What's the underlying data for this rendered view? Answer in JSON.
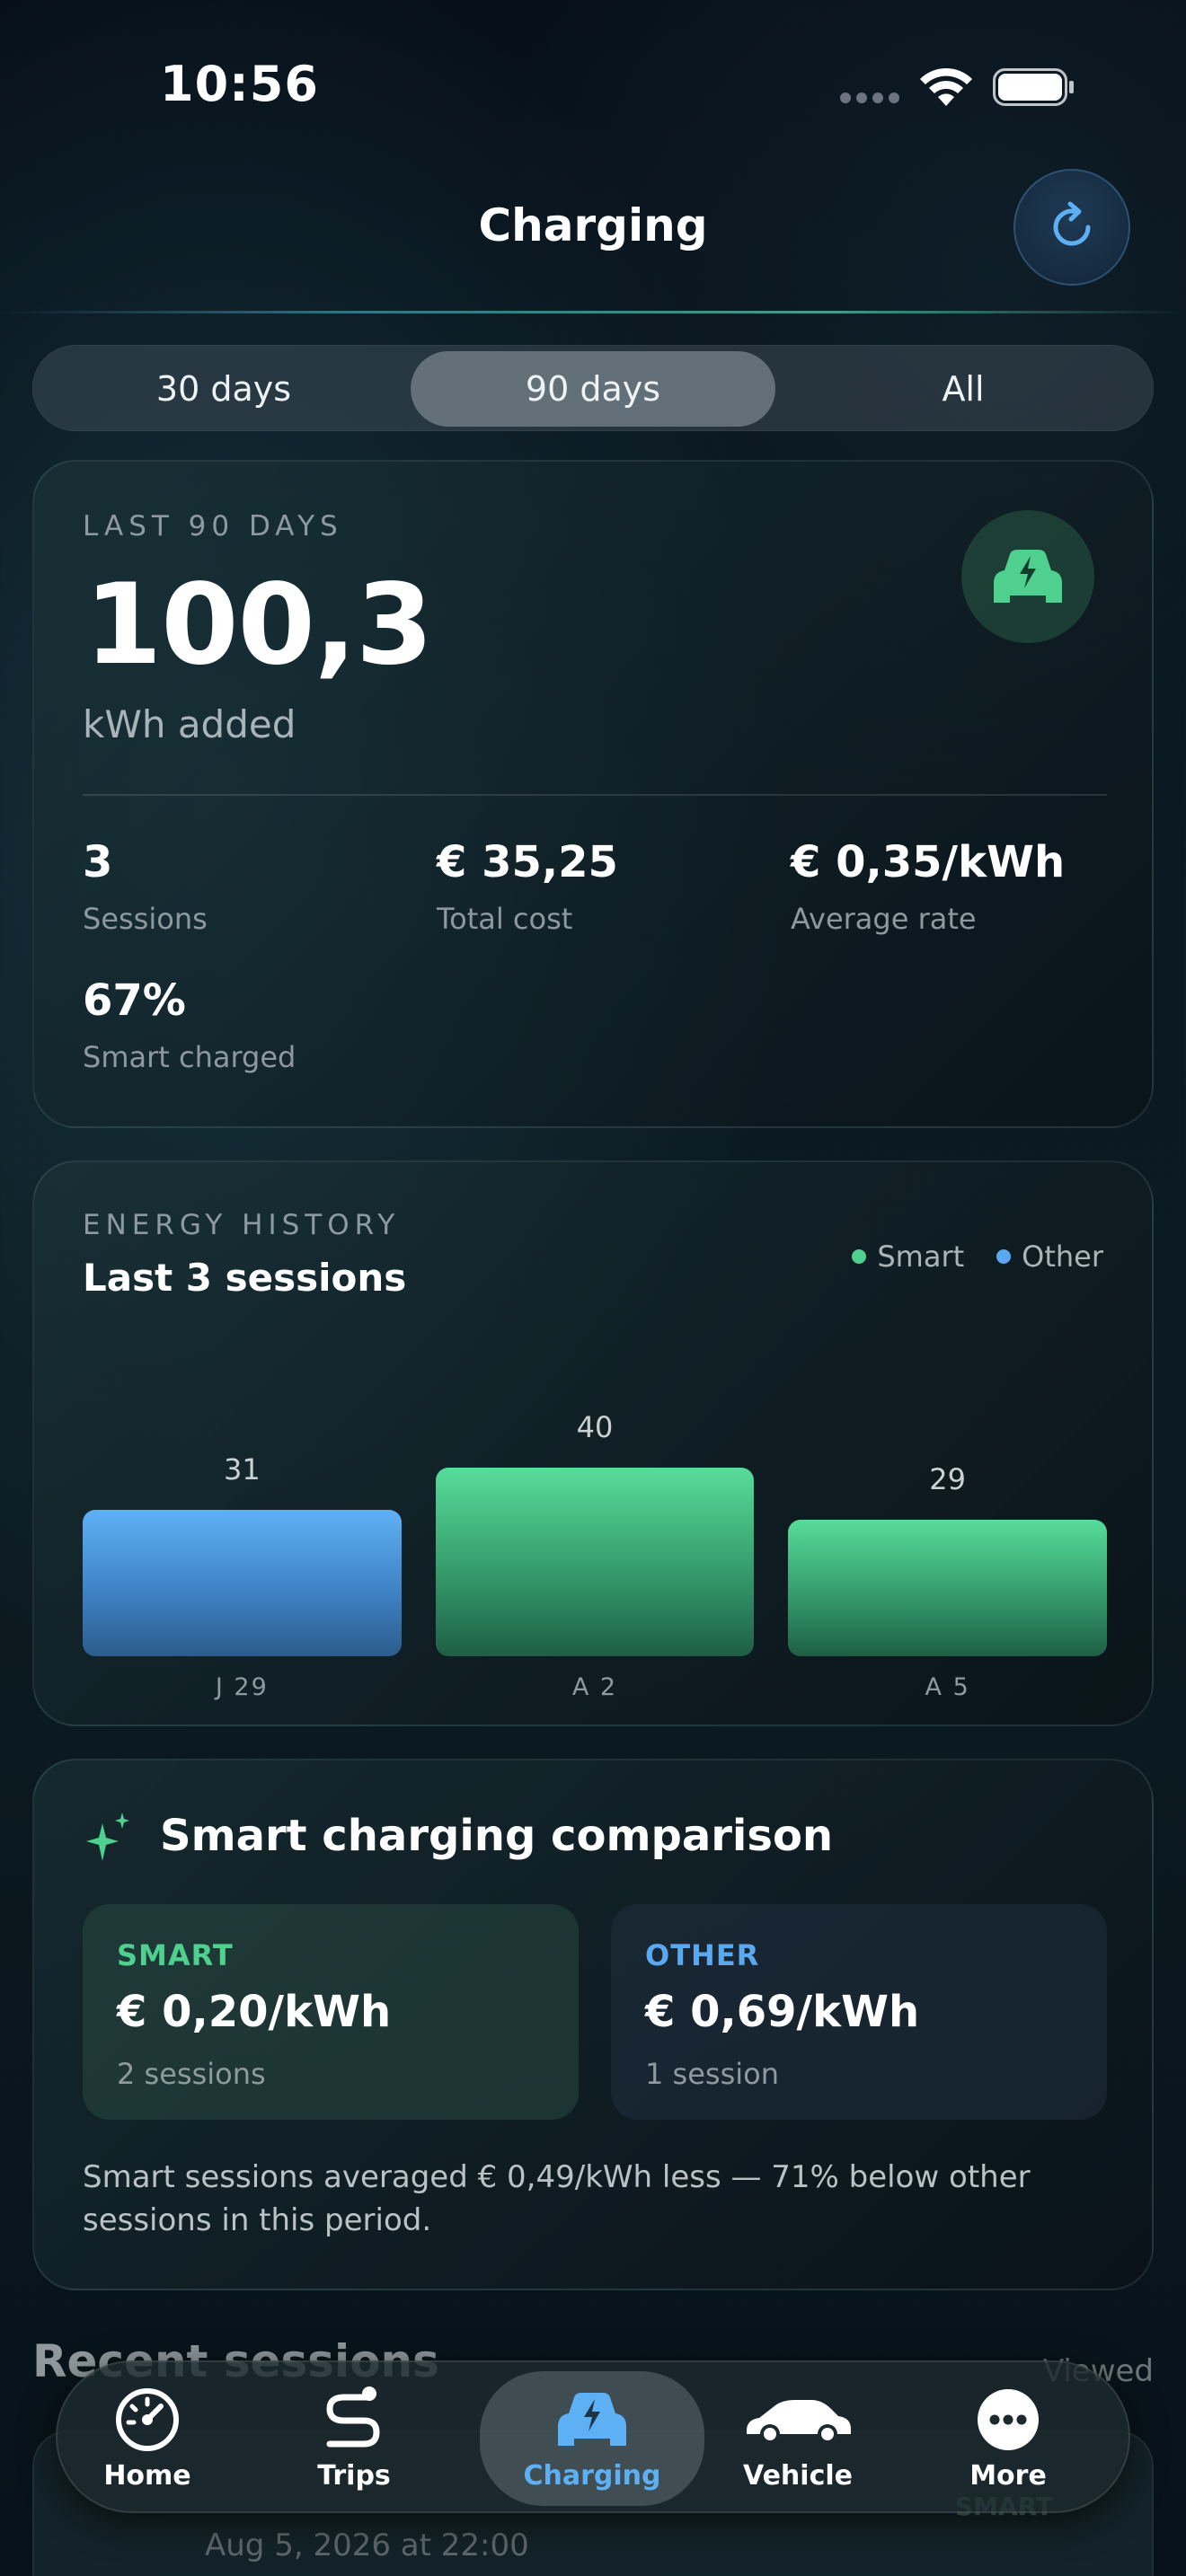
{
  "status_bar": {
    "time": "10:56"
  },
  "header": {
    "title": "Charging"
  },
  "range_tabs": [
    {
      "label": "30 days",
      "selected": false
    },
    {
      "label": "90 days",
      "selected": true
    },
    {
      "label": "All",
      "selected": false
    }
  ],
  "summary": {
    "eyebrow": "LAST 90 DAYS",
    "energy_value": "100,3",
    "energy_unit": "kWh added",
    "stats": [
      {
        "value": "3",
        "label": "Sessions"
      },
      {
        "value": "€ 35,25",
        "label": "Total cost"
      },
      {
        "value": "€ 0,35/kWh",
        "label": "Average rate"
      },
      {
        "value": "67%",
        "label": "Smart charged"
      }
    ]
  },
  "history": {
    "eyebrow": "ENERGY HISTORY",
    "title": "Last 3 sessions",
    "legend": [
      {
        "label": "Smart",
        "color": "#4fd08f"
      },
      {
        "label": "Other",
        "color": "#5aa9f0"
      }
    ]
  },
  "chart_data": {
    "type": "bar",
    "title": "Last 3 sessions",
    "categories": [
      "J 29",
      "A 2",
      "A 5"
    ],
    "values": [
      31,
      40,
      29
    ],
    "bar_types": [
      "Other",
      "Smart",
      "Smart"
    ],
    "data_labels": [
      "31",
      "40",
      "29"
    ],
    "ylim": [
      0,
      40
    ],
    "grid": false,
    "legend_position": "top-right"
  },
  "comparison": {
    "title": "Smart charging comparison",
    "smart": {
      "tag": "SMART",
      "rate": "€ 0,20/kWh",
      "sessions": "2 sessions"
    },
    "other": {
      "tag": "OTHER",
      "rate": "€ 0,69/kWh",
      "sessions": "1 session"
    },
    "note": "Smart sessions averaged € 0,49/kWh less — 71% below other sessions in this period."
  },
  "recent": {
    "title": "Recent sessions",
    "action": "Viewed",
    "first_row": {
      "date": "Aug 5, 2026 at 22:00",
      "tag": "SMART"
    }
  },
  "nav": [
    {
      "label": "Home",
      "icon": "speedometer-icon",
      "active": false
    },
    {
      "label": "Trips",
      "icon": "route-icon",
      "active": false
    },
    {
      "label": "Charging",
      "icon": "charging-car-icon",
      "active": true
    },
    {
      "label": "Vehicle",
      "icon": "car-icon",
      "active": false
    },
    {
      "label": "More",
      "icon": "more-icon",
      "active": false
    }
  ],
  "colors": {
    "smart": "#4fd08f",
    "other": "#5aa9f0",
    "accent_blue": "#5db0f3"
  }
}
